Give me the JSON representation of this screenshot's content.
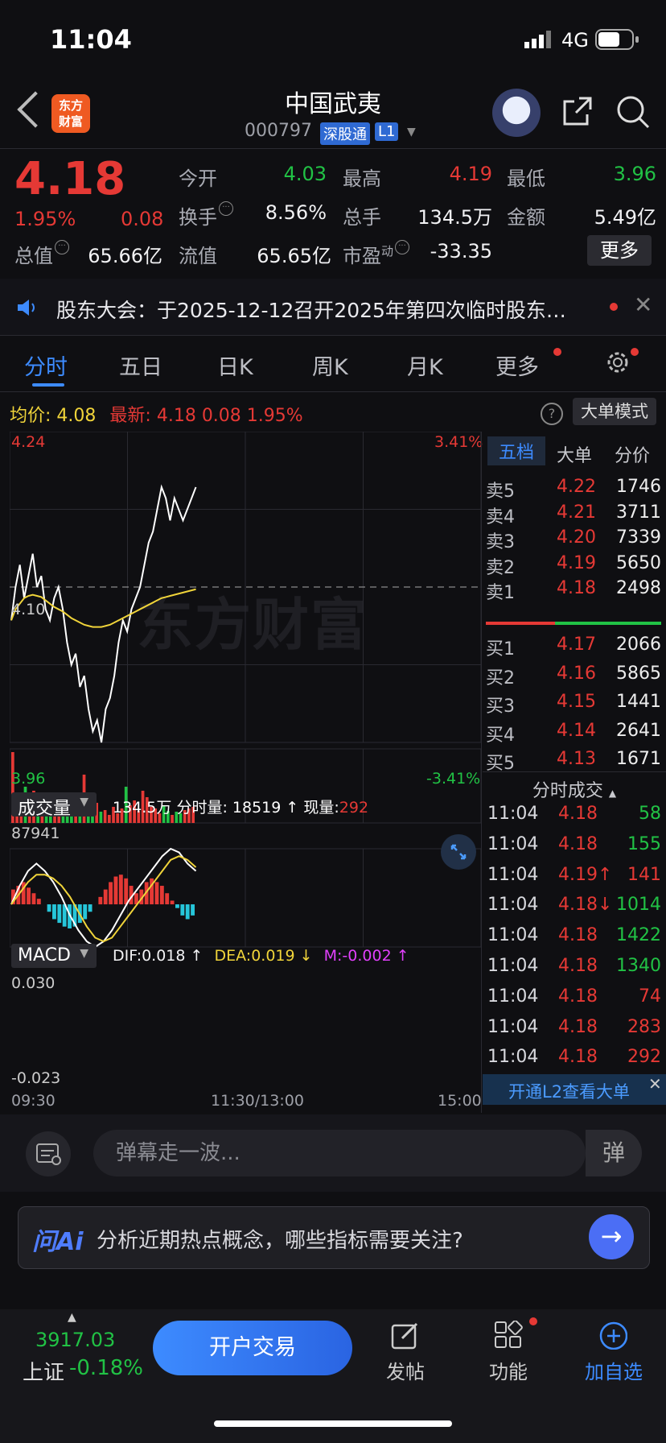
{
  "status": {
    "time": "11:04",
    "network": "4G"
  },
  "header": {
    "logo_line1": "东方",
    "logo_line2": "财富",
    "name": "中国武夷",
    "code": "000797",
    "tag_connect": "深股通",
    "tag_level": "L1"
  },
  "quote": {
    "price": "4.18",
    "change_pct": "1.95%",
    "change": "0.08",
    "fields": [
      {
        "label": "今开",
        "value": "4.03",
        "color": "#21c245"
      },
      {
        "label": "最高",
        "value": "4.19",
        "color": "#e53935"
      },
      {
        "label": "最低",
        "value": "3.96",
        "color": "#21c245"
      },
      {
        "label": "换手",
        "value": "8.56%",
        "color": "#f2f2f4"
      },
      {
        "label": "总手",
        "value": "134.5万",
        "color": "#f2f2f4"
      },
      {
        "label": "金额",
        "value": "5.49亿",
        "color": "#f2f2f4"
      },
      {
        "label": "总值",
        "value": "65.66亿",
        "color": "#f2f2f4"
      },
      {
        "label": "流值",
        "value": "65.65亿",
        "color": "#f2f2f4"
      },
      {
        "label": "市盈",
        "value": "-33.35",
        "color": "#f2f2f4"
      }
    ],
    "pe_sup": "动",
    "more_label": "更多"
  },
  "notice": {
    "text": "股东大会：于2025-12-12召开2025年第四次临时股东…"
  },
  "tabs": [
    "分时",
    "五日",
    "日K",
    "周K",
    "月K",
    "更多"
  ],
  "info": {
    "avg_label": "均价:",
    "avg_value": "4.08",
    "latest_label": "最新:",
    "latest_value": "4.18",
    "latest_change": "0.08",
    "latest_pct": "1.95%",
    "help": "?",
    "big_order_mode": "大单模式"
  },
  "chart_data": {
    "type": "line",
    "price_axis": {
      "high": "4.24",
      "mid": "4.10",
      "low": "3.96",
      "high_pct": "3.41%",
      "low_pct": "-3.41%"
    },
    "ylim": [
      3.96,
      4.24
    ],
    "prev_close": 4.1,
    "time_labels": [
      "09:30",
      "11:30/13:00",
      "15:00"
    ],
    "price": [
      4.07,
      4.1,
      4.12,
      4.09,
      4.11,
      4.13,
      4.1,
      4.11,
      4.08,
      4.07,
      4.09,
      4.1,
      4.08,
      4.05,
      4.03,
      4.04,
      4.01,
      4.02,
      3.99,
      3.97,
      3.98,
      3.96,
      3.99,
      4.0,
      4.02,
      4.05,
      4.07,
      4.06,
      4.08,
      4.09,
      4.1,
      4.12,
      4.14,
      4.15,
      4.17,
      4.19,
      4.18,
      4.16,
      4.18,
      4.17,
      4.16,
      4.17,
      4.18,
      4.19
    ],
    "avg": [
      4.07,
      4.08,
      4.085,
      4.09,
      4.092,
      4.093,
      4.092,
      4.091,
      4.088,
      4.085,
      4.082,
      4.08,
      4.078,
      4.075,
      4.072,
      4.07,
      4.068,
      4.066,
      4.065,
      4.064,
      4.064,
      4.064,
      4.065,
      4.066,
      4.068,
      4.07,
      4.072,
      4.074,
      4.076,
      4.078,
      4.08,
      4.082,
      4.084,
      4.086,
      4.088,
      4.09,
      4.091,
      4.092,
      4.093,
      4.094,
      4.095,
      4.096,
      4.097,
      4.098
    ],
    "volume_max_label": "87941",
    "volume": [
      87941,
      30000,
      22000,
      45000,
      18000,
      40000,
      25000,
      20000,
      35000,
      15000,
      28000,
      12000,
      18000,
      22000,
      10000,
      15000,
      20000,
      60000,
      12000,
      18000,
      25000,
      14000,
      16000,
      10000,
      20000,
      12000,
      18000,
      45000,
      22000,
      28000,
      15000,
      40000,
      32000,
      20000,
      18000,
      12000,
      22000,
      15000,
      10000,
      14000,
      12000,
      16000,
      18000,
      20000
    ],
    "macd": {
      "max_label": "0.030",
      "min_label": "-0.023",
      "ymax": 0.03,
      "ymin": -0.023,
      "hist": [
        0.008,
        0.01,
        0.012,
        0.009,
        0.006,
        0.003,
        0.0,
        -0.004,
        -0.008,
        -0.01,
        -0.012,
        -0.013,
        -0.012,
        -0.01,
        -0.008,
        -0.004,
        0.0,
        0.004,
        0.008,
        0.012,
        0.015,
        0.016,
        0.014,
        0.01,
        0.006,
        0.008,
        0.012,
        0.014,
        0.012,
        0.01,
        0.006,
        0.002,
        -0.002,
        -0.006,
        -0.008,
        -0.006
      ],
      "dif": [
        0.0,
        0.01,
        0.018,
        0.022,
        0.018,
        0.012,
        0.004,
        -0.006,
        -0.014,
        -0.02,
        -0.023,
        -0.02,
        -0.014,
        -0.006,
        0.002,
        0.008,
        0.014,
        0.02,
        0.026,
        0.03,
        0.028,
        0.022,
        0.018
      ],
      "dea": [
        0.0,
        0.006,
        0.012,
        0.016,
        0.016,
        0.014,
        0.01,
        0.004,
        -0.004,
        -0.012,
        -0.018,
        -0.02,
        -0.018,
        -0.012,
        -0.006,
        0.0,
        0.006,
        0.012,
        0.018,
        0.024,
        0.026,
        0.024,
        0.02
      ]
    }
  },
  "volume_panel": {
    "dropdown": "成交量",
    "total": "134.5万",
    "minute_label": "分时量:",
    "minute_value": "18519",
    "minute_arrow": "↑",
    "now_label": "现量:",
    "now_value": "292"
  },
  "macd_panel": {
    "dropdown": "MACD",
    "dif": "DIF:0.018 ↑",
    "dea": "DEA:0.019 ↓",
    "m": "M:-0.002 ↑"
  },
  "watermark": "东方财富",
  "right_panel": {
    "tabs": [
      "五档",
      "大单",
      "分价"
    ],
    "asks": [
      {
        "label": "卖5",
        "price": "4.22",
        "vol": "1746"
      },
      {
        "label": "卖4",
        "price": "4.21",
        "vol": "3711"
      },
      {
        "label": "卖3",
        "price": "4.20",
        "vol": "7339"
      },
      {
        "label": "卖2",
        "price": "4.19",
        "vol": "5650"
      },
      {
        "label": "卖1",
        "price": "4.18",
        "vol": "2498"
      }
    ],
    "bids": [
      {
        "label": "买1",
        "price": "4.17",
        "vol": "2066"
      },
      {
        "label": "买2",
        "price": "4.16",
        "vol": "5865"
      },
      {
        "label": "买3",
        "price": "4.15",
        "vol": "1441"
      },
      {
        "label": "买4",
        "price": "4.14",
        "vol": "2641"
      },
      {
        "label": "买5",
        "price": "4.13",
        "vol": "1671"
      }
    ],
    "ticks_title": "分时成交",
    "ticks": [
      {
        "time": "11:04",
        "price": "4.18",
        "vol": "58",
        "vol_color": "#21c245"
      },
      {
        "time": "11:04",
        "price": "4.18",
        "vol": "155",
        "vol_color": "#21c245"
      },
      {
        "time": "11:04",
        "price": "4.19↑",
        "vol": "141",
        "vol_color": "#e53935"
      },
      {
        "time": "11:04",
        "price": "4.18↓",
        "vol": "1014",
        "vol_color": "#21c245"
      },
      {
        "time": "11:04",
        "price": "4.18",
        "vol": "1422",
        "vol_color": "#21c245"
      },
      {
        "time": "11:04",
        "price": "4.18",
        "vol": "1340",
        "vol_color": "#21c245"
      },
      {
        "time": "11:04",
        "price": "4.18",
        "vol": "74",
        "vol_color": "#e53935"
      },
      {
        "time": "11:04",
        "price": "4.18",
        "vol": "283",
        "vol_color": "#e53935"
      },
      {
        "time": "11:04",
        "price": "4.18",
        "vol": "292",
        "vol_color": "#e53935"
      }
    ],
    "l2_banner": "开通L2查看大单"
  },
  "danmu": {
    "placeholder": "弹幕走一波...",
    "send": "弹"
  },
  "ai": {
    "logo": "问Ai",
    "prompt": "分析近期热点概念，哪些指标需要关注?"
  },
  "bottom_nav": {
    "index_value": "3917.03",
    "index_label": "上证",
    "index_change": "-0.18%",
    "trade": "开户交易",
    "items": [
      "发帖",
      "功能",
      "加自选"
    ]
  }
}
